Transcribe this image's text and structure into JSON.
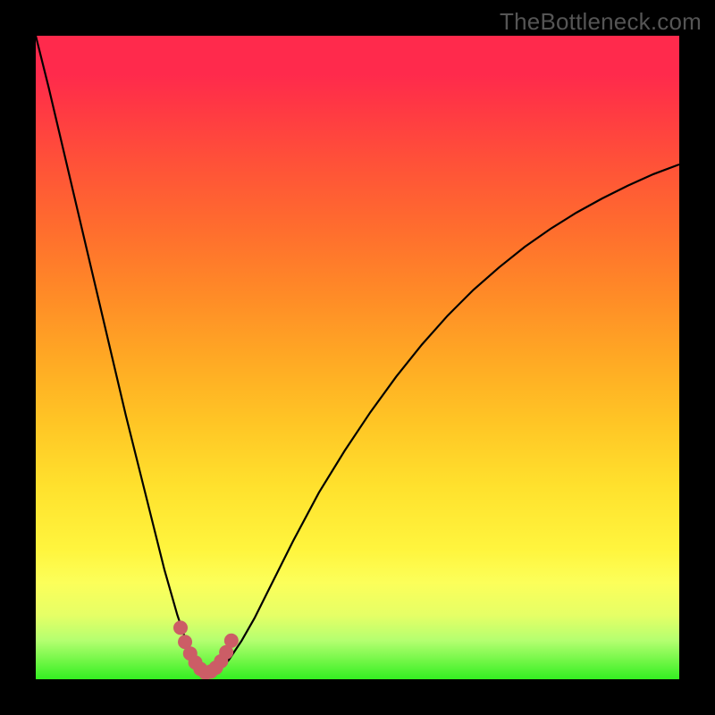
{
  "watermark": "TheBottleneck.com",
  "colors": {
    "frame": "#000000",
    "curve": "#000000",
    "marker": "#cc5d66",
    "gradient_stops": [
      "#ff2a4c",
      "#ff3545",
      "#ff5238",
      "#ff6d2e",
      "#ff8a27",
      "#ffa824",
      "#ffc525",
      "#ffe12d",
      "#fff53e",
      "#fcff5a",
      "#e6ff66",
      "#b4ff70",
      "#34ef21"
    ]
  },
  "chart_data": {
    "type": "line",
    "title": "",
    "xlabel": "",
    "ylabel": "",
    "xlim": [
      0,
      100
    ],
    "ylim": [
      0,
      100
    ],
    "x": [
      0,
      2,
      4,
      6,
      8,
      10,
      12,
      14,
      16,
      18,
      20,
      22,
      23,
      24,
      25,
      26,
      27,
      28,
      29,
      30,
      32,
      34,
      36,
      38,
      40,
      44,
      48,
      52,
      56,
      60,
      64,
      68,
      72,
      76,
      80,
      84,
      88,
      92,
      96,
      100
    ],
    "y": [
      100,
      92,
      83.5,
      75,
      66.5,
      58,
      49.5,
      41,
      33,
      25,
      17,
      10,
      7,
      4.5,
      2.5,
      1.4,
      1,
      1.2,
      1.9,
      3,
      6,
      9.5,
      13.5,
      17.5,
      21.5,
      29,
      35.5,
      41.5,
      47,
      52,
      56.5,
      60.5,
      64,
      67.2,
      70,
      72.5,
      74.7,
      76.7,
      78.5,
      80
    ],
    "markers": {
      "x": [
        22.5,
        23.2,
        24.0,
        24.8,
        25.6,
        26.4,
        27.2,
        28.0,
        28.8,
        29.6,
        30.4
      ],
      "y": [
        8.0,
        5.8,
        4.0,
        2.6,
        1.6,
        1.0,
        1.2,
        1.8,
        2.8,
        4.2,
        6.0
      ]
    }
  }
}
